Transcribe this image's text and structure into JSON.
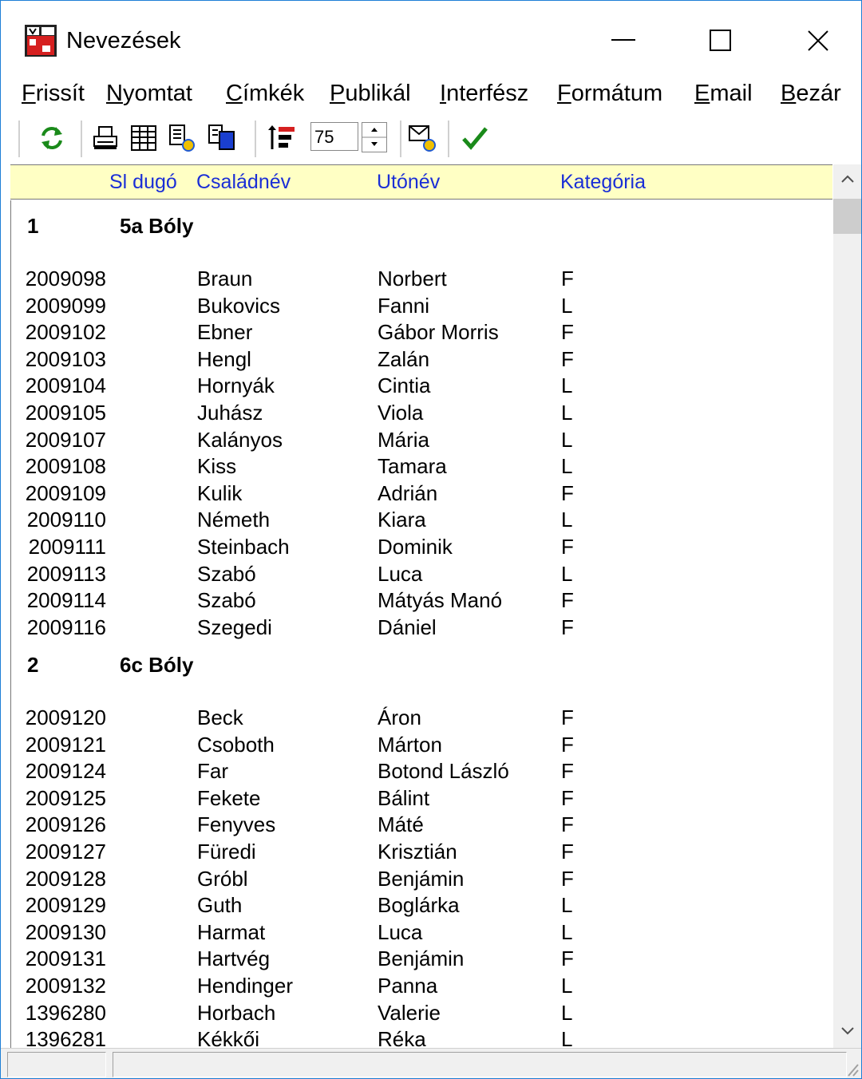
{
  "window": {
    "title": "Nevezések",
    "minimize_glyph": "—",
    "maximize_glyph": "☐",
    "close_glyph": "✕"
  },
  "menu": {
    "items": [
      {
        "label": "Frissít"
      },
      {
        "label": "Nyomtat"
      },
      {
        "label": "Címkék"
      },
      {
        "label": "Publikál"
      },
      {
        "label": "Interfész"
      },
      {
        "label": "Formátum"
      },
      {
        "label": "Email"
      },
      {
        "label": "Bezár"
      }
    ]
  },
  "toolbar": {
    "zoom_value": "75",
    "icons": [
      "refresh-icon",
      "print-icon",
      "table-icon",
      "export-icon",
      "copy-icon",
      "sort-icon",
      "email-icon",
      "check-icon"
    ]
  },
  "columns": {
    "id": "Sl dugó",
    "last": "Családnév",
    "first": "Utónév",
    "category": "Kategória"
  },
  "groups": [
    {
      "number": "1",
      "name": "5a Bóly",
      "rows": [
        {
          "id": "2009098",
          "last": "Braun",
          "first": "Norbert",
          "cat": "F"
        },
        {
          "id": "2009099",
          "last": "Bukovics",
          "first": "Fanni",
          "cat": "L"
        },
        {
          "id": "2009102",
          "last": "Ebner",
          "first": "Gábor Morris",
          "cat": "F"
        },
        {
          "id": "2009103",
          "last": "Hengl",
          "first": "Zalán",
          "cat": "F"
        },
        {
          "id": "2009104",
          "last": "Hornyák",
          "first": "Cintia",
          "cat": "L"
        },
        {
          "id": "2009105",
          "last": "Juhász",
          "first": "Viola",
          "cat": "L"
        },
        {
          "id": "2009107",
          "last": "Kalányos",
          "first": "Mária",
          "cat": "L"
        },
        {
          "id": "2009108",
          "last": "Kiss",
          "first": "Tamara",
          "cat": "L"
        },
        {
          "id": "2009109",
          "last": "Kulik",
          "first": "Adrián",
          "cat": "F"
        },
        {
          "id": "2009110",
          "last": "Németh",
          "first": "Kiara",
          "cat": "L"
        },
        {
          "id": "2009111",
          "last": "Steinbach",
          "first": "Dominik",
          "cat": "F"
        },
        {
          "id": "2009113",
          "last": "Szabó",
          "first": "Luca",
          "cat": "L"
        },
        {
          "id": "2009114",
          "last": "Szabó",
          "first": "Mátyás Manó",
          "cat": "F"
        },
        {
          "id": "2009116",
          "last": "Szegedi",
          "first": "Dániel",
          "cat": "F"
        }
      ]
    },
    {
      "number": "2",
      "name": "6c Bóly",
      "rows": [
        {
          "id": "2009120",
          "last": "Beck",
          "first": "Áron",
          "cat": "F"
        },
        {
          "id": "2009121",
          "last": "Csoboth",
          "first": "Márton",
          "cat": "F"
        },
        {
          "id": "2009124",
          "last": "Far",
          "first": "Botond László",
          "cat": "F"
        },
        {
          "id": "2009125",
          "last": "Fekete",
          "first": "Bálint",
          "cat": "F"
        },
        {
          "id": "2009126",
          "last": "Fenyves",
          "first": "Máté",
          "cat": "F"
        },
        {
          "id": "2009127",
          "last": "Füredi",
          "first": "Krisztián",
          "cat": "F"
        },
        {
          "id": "2009128",
          "last": "Gróbl",
          "first": "Benjámin",
          "cat": "F"
        },
        {
          "id": "2009129",
          "last": "Guth",
          "first": "Boglárka",
          "cat": "L"
        },
        {
          "id": "2009130",
          "last": "Harmat",
          "first": "Luca",
          "cat": "L"
        },
        {
          "id": "2009131",
          "last": "Hartvég",
          "first": "Benjámin",
          "cat": "F"
        },
        {
          "id": "2009132",
          "last": "Hendinger",
          "first": "Panna",
          "cat": "L"
        },
        {
          "id": "1396280",
          "last": "Horbach",
          "first": "Valerie",
          "cat": "L"
        },
        {
          "id": "1396281",
          "last": "Kékkői",
          "first": "Réka",
          "cat": "L"
        }
      ]
    }
  ],
  "colors": {
    "header_bg": "#ffffc4",
    "header_text": "#1a2ed6",
    "window_border": "#1e7fd6",
    "check": "#1a8a1a",
    "refresh": "#1a8a1a"
  }
}
